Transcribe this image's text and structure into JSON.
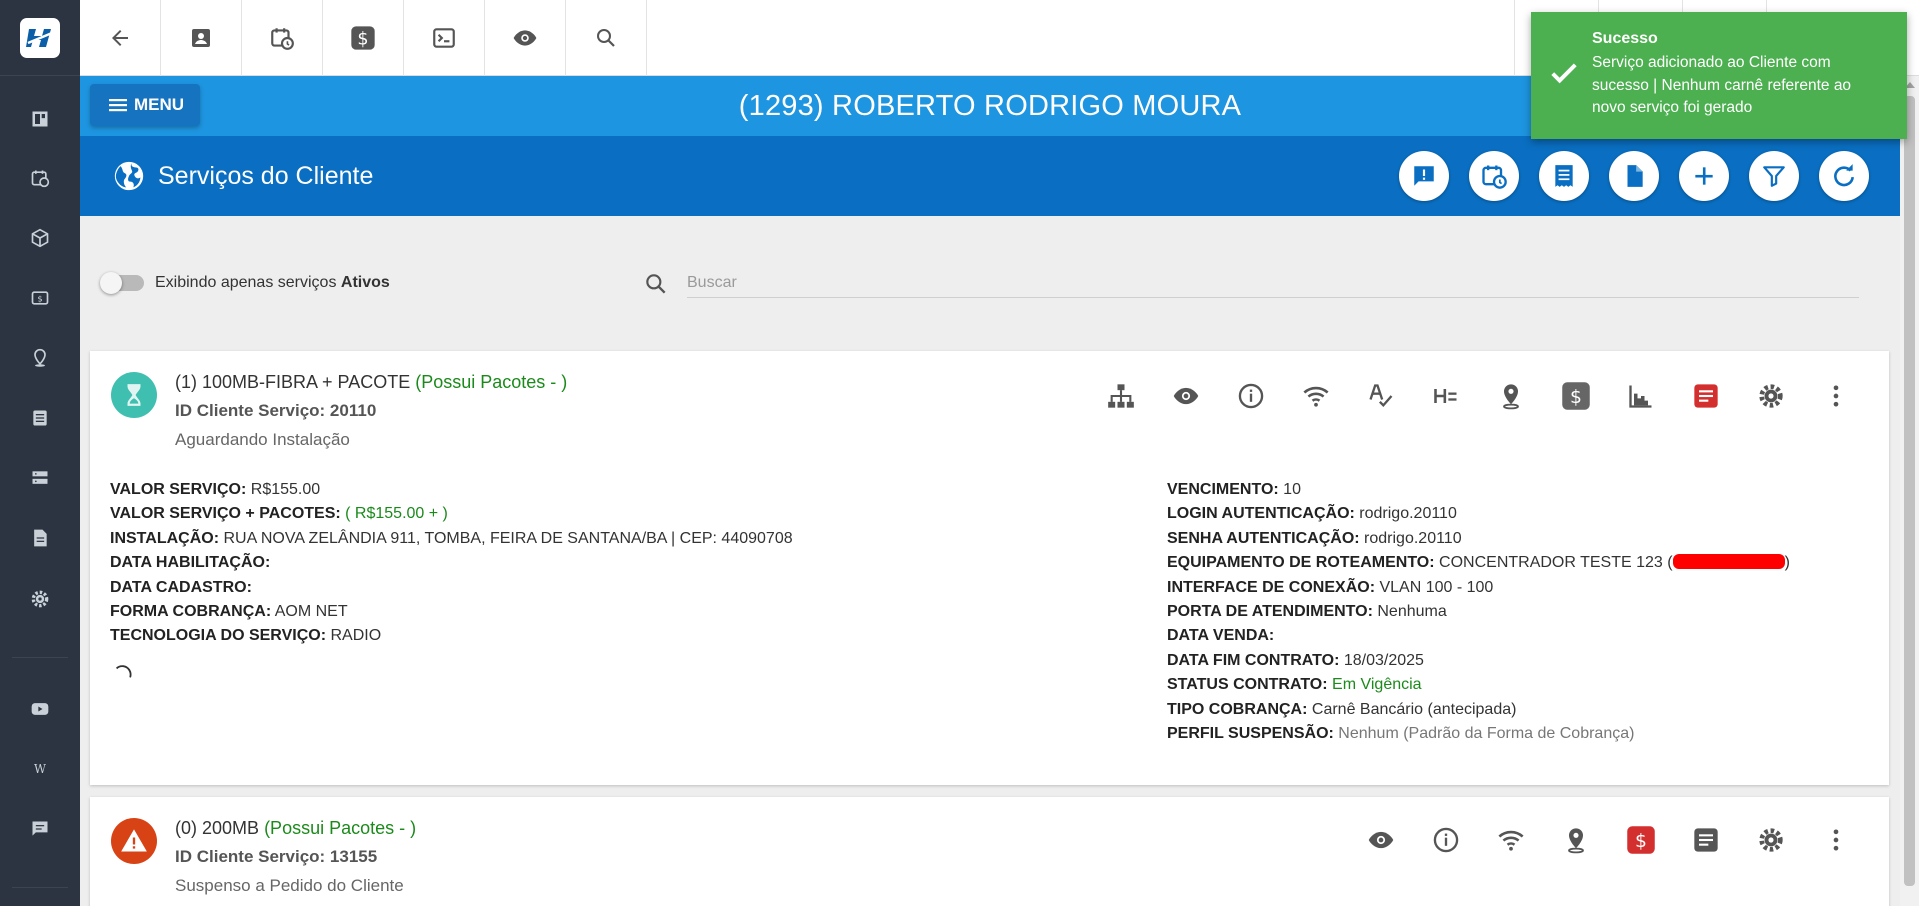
{
  "client": {
    "title": "(1293) ROBERTO RODRIGO MOURA",
    "menu_label": "MENU"
  },
  "section": {
    "title": "Serviços do Cliente"
  },
  "filter": {
    "toggle_label": "Exibindo apenas serviços ",
    "toggle_bold": "Ativos",
    "toggle_on": false
  },
  "search": {
    "placeholder": "Buscar",
    "value": ""
  },
  "toast": {
    "title": "Sucesso",
    "message": "Serviço adicionado ao Cliente com sucesso | Nenhum carnê referente ao novo serviço foi gerado",
    "color": "#4caf50"
  },
  "colors": {
    "primary_blue": "#1e95e0",
    "section_blue": "#0a6fc2",
    "sidebar": "#2b3440",
    "success_green": "#1b8a1b",
    "danger_red": "#d32f2f"
  },
  "services": [
    {
      "title": "(1) 100MB-FIBRA + PACOTE",
      "pacote": "(Possui Pacotes - )",
      "id_label": "ID Cliente Serviço: 20110",
      "status": "Aguardando Instalação",
      "status_icon": "hourglass-icon",
      "left": [
        {
          "label": "VALOR SERVIÇO:",
          "value": "R$155.00"
        },
        {
          "label": "VALOR SERVIÇO + PACOTES:",
          "value": "( R$155.00 + )"
        },
        {
          "label": "INSTALAÇÃO:",
          "value": "RUA NOVA ZELÂNDIA 911, TOMBA, FEIRA DE SANTANA/BA | CEP: 44090708"
        },
        {
          "label": "DATA HABILITAÇÃO:",
          "value": ""
        },
        {
          "label": "DATA CADASTRO:",
          "value": ""
        },
        {
          "label": "FORMA COBRANÇA:",
          "value": "AOM NET"
        },
        {
          "label": "TECNOLOGIA DO SERVIÇO:",
          "value": "RADIO"
        }
      ],
      "right": [
        {
          "label": "VENCIMENTO:",
          "value": "10"
        },
        {
          "label": "LOGIN AUTENTICAÇÃO:",
          "value": "rodrigo.20110"
        },
        {
          "label": "SENHA AUTENTICAÇÃO:",
          "value": "rodrigo.20110"
        },
        {
          "label": "EQUIPAMENTO DE ROTEAMENTO:",
          "value": "CONCENTRADOR TESTE 123 (",
          "value_end": ")"
        },
        {
          "label": "INTERFACE DE CONEXÃO:",
          "value": "VLAN 100 - 100"
        },
        {
          "label": "PORTA DE ATENDIMENTO:",
          "value": "Nenhuma"
        },
        {
          "label": "DATA VENDA:",
          "value": ""
        },
        {
          "label": "DATA FIM CONTRATO:",
          "value": "18/03/2025"
        },
        {
          "label": "STATUS CONTRATO:",
          "value": "Em Vigência"
        },
        {
          "label": "TIPO COBRANÇA:",
          "value": "Carnê Bancário (antecipada)"
        },
        {
          "label": "PERFIL SUSPENSÃO:",
          "value": "Nenhum (Padrão da Forma de Cobrança)"
        }
      ]
    },
    {
      "title": "(0) 200MB",
      "pacote": "(Possui Pacotes - )",
      "id_label": "ID Cliente Serviço: 13155",
      "status": "Suspenso a Pedido do Cliente",
      "status_icon": "warning-icon"
    }
  ]
}
